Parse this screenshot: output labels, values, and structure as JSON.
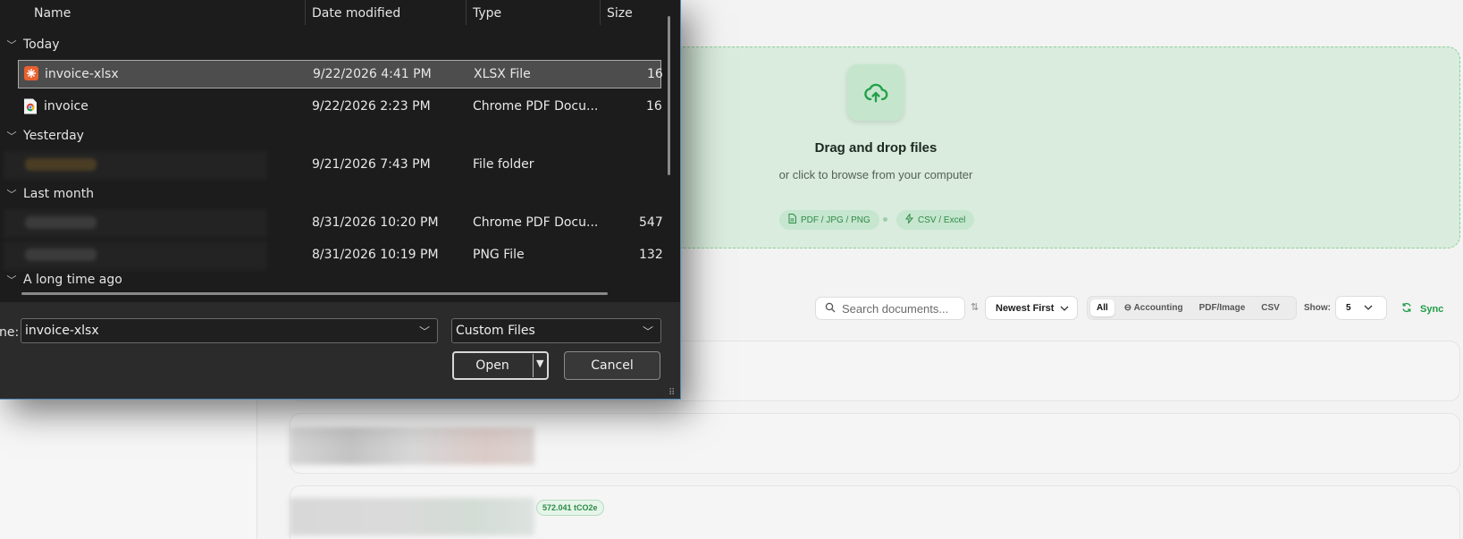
{
  "upload": {
    "title": "Drag and drop files",
    "subtitle": "or click to browse from your computer",
    "chips": [
      "PDF / JPG / PNG",
      "CSV / Excel"
    ]
  },
  "toolbar": {
    "search_placeholder": "Search documents...",
    "sort_value": "Newest First",
    "filters": [
      "All",
      "Accounting",
      "PDF/Image",
      "CSV"
    ],
    "active_filter": "All",
    "show_label": "Show:",
    "show_value": "5",
    "sync_label": "Sync"
  },
  "documents": {
    "co2_badge": "572.041 tCO2e"
  },
  "dialog": {
    "columns": {
      "name": "Name",
      "date": "Date modified",
      "type": "Type",
      "size": "Size"
    },
    "groups": {
      "today": "Today",
      "yesterday": "Yesterday",
      "last_month": "Last month",
      "long_ago": "A long time ago"
    },
    "files": [
      {
        "name": "invoice-xlsx",
        "date": "9/22/2026 4:41 PM",
        "type": "XLSX File",
        "size": "16",
        "icon": "spreadsheet-icon"
      },
      {
        "name": "invoice",
        "date": "9/22/2026 2:23 PM",
        "type": "Chrome PDF Docu...",
        "size": "16",
        "icon": "chrome-pdf-icon"
      },
      {
        "name": "",
        "date": "9/21/2026 7:43 PM",
        "type": "File folder",
        "size": ""
      },
      {
        "name": "",
        "date": "8/31/2026 10:20 PM",
        "type": "Chrome PDF Docu...",
        "size": "547"
      },
      {
        "name": "",
        "date": "8/31/2026 10:19 PM",
        "type": "PNG File",
        "size": "132"
      }
    ],
    "file_name_label": "ne:",
    "file_name_value": "invoice-xlsx",
    "file_type_value": "Custom Files",
    "open_label": "Open",
    "cancel_label": "Cancel"
  },
  "colors": {
    "accent_green": "#1f9d47",
    "upload_bg": "#d9ecdd",
    "dialog_bg": "#1c1c1c"
  }
}
